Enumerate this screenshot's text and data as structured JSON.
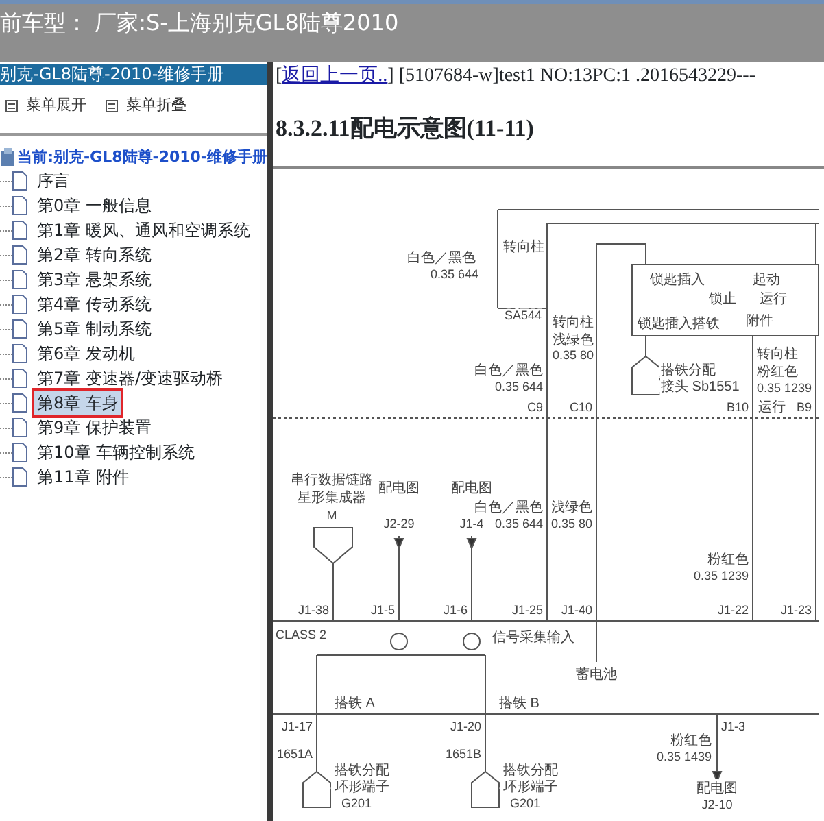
{
  "top_bar": {
    "title": "前车型： 厂家:S-上海别克GL8陆尊2010"
  },
  "sidebar": {
    "header": "别克-GL8陆尊-2010-维修手册",
    "tools": [
      {
        "label": "菜单展开"
      },
      {
        "label": "菜单折叠"
      }
    ],
    "root": "当前:别克-GL8陆尊-2010-维修手册",
    "items": [
      {
        "label": "序言",
        "selected": false,
        "annotated": false
      },
      {
        "label": "第0章 一般信息",
        "selected": false,
        "annotated": false
      },
      {
        "label": "第1章 暖风、通风和空调系统",
        "selected": false,
        "annotated": false
      },
      {
        "label": "第2章 转向系统",
        "selected": false,
        "annotated": false
      },
      {
        "label": "第3章 悬架系统",
        "selected": false,
        "annotated": false
      },
      {
        "label": "第4章 传动系统",
        "selected": false,
        "annotated": false
      },
      {
        "label": "第5章 制动系统",
        "selected": false,
        "annotated": false
      },
      {
        "label": "第6章 发动机",
        "selected": false,
        "annotated": false
      },
      {
        "label": "第7章 变速器/变速驱动桥",
        "selected": false,
        "annotated": false
      },
      {
        "label": "第8章 车身",
        "selected": true,
        "annotated": true
      },
      {
        "label": "第9章 保护装置",
        "selected": false,
        "annotated": false
      },
      {
        "label": "第10章 车辆控制系统",
        "selected": false,
        "annotated": false
      },
      {
        "label": "第11章 附件",
        "selected": false,
        "annotated": false
      }
    ]
  },
  "content": {
    "bracket_open": "[",
    "back_link": "返回上一页..",
    "info": "] [5107684-w]test1 NO:13PC:1 .2016543229---",
    "heading": "8.3.2.11配电示意图(11-11)",
    "diagram": {
      "labels": [
        "转向柱",
        "白色／黑色",
        "0.35 644",
        "锁匙插入",
        "起动",
        "锁止",
        "运行",
        "SA544",
        "转向柱",
        "锁匙插入搭铁",
        "附件",
        "浅绿色",
        "0.35 80",
        "转向柱",
        "白色／黑色",
        "搭铁分配",
        "粉红色",
        "0.35 644",
        "接头 Sb1551",
        "0.35 1239",
        "C9",
        "C10",
        "B10",
        "运行",
        "B9",
        "串行数据链路",
        "配电图",
        "配电图",
        "星形集成器",
        "白色／黑色",
        "浅绿色",
        "M",
        "J2-29",
        "J1-4",
        "0.35 644",
        "0.35 80",
        "粉红色",
        "0.35 1239",
        "J1-38",
        "J1-5",
        "J1-6",
        "J1-25",
        "J1-40",
        "J1-22",
        "J1-23",
        "CLASS 2",
        "信号采集输入",
        "蓄电池",
        "搭铁 A",
        "搭铁 B",
        "J1-17",
        "J1-20",
        "J1-3",
        "粉红色",
        "1651A",
        "1651B",
        "0.35 1439",
        "搭铁分配",
        "搭铁分配",
        "环形端子",
        "环形端子",
        "配电图",
        "G201",
        "G201",
        "J2-10"
      ]
    }
  }
}
